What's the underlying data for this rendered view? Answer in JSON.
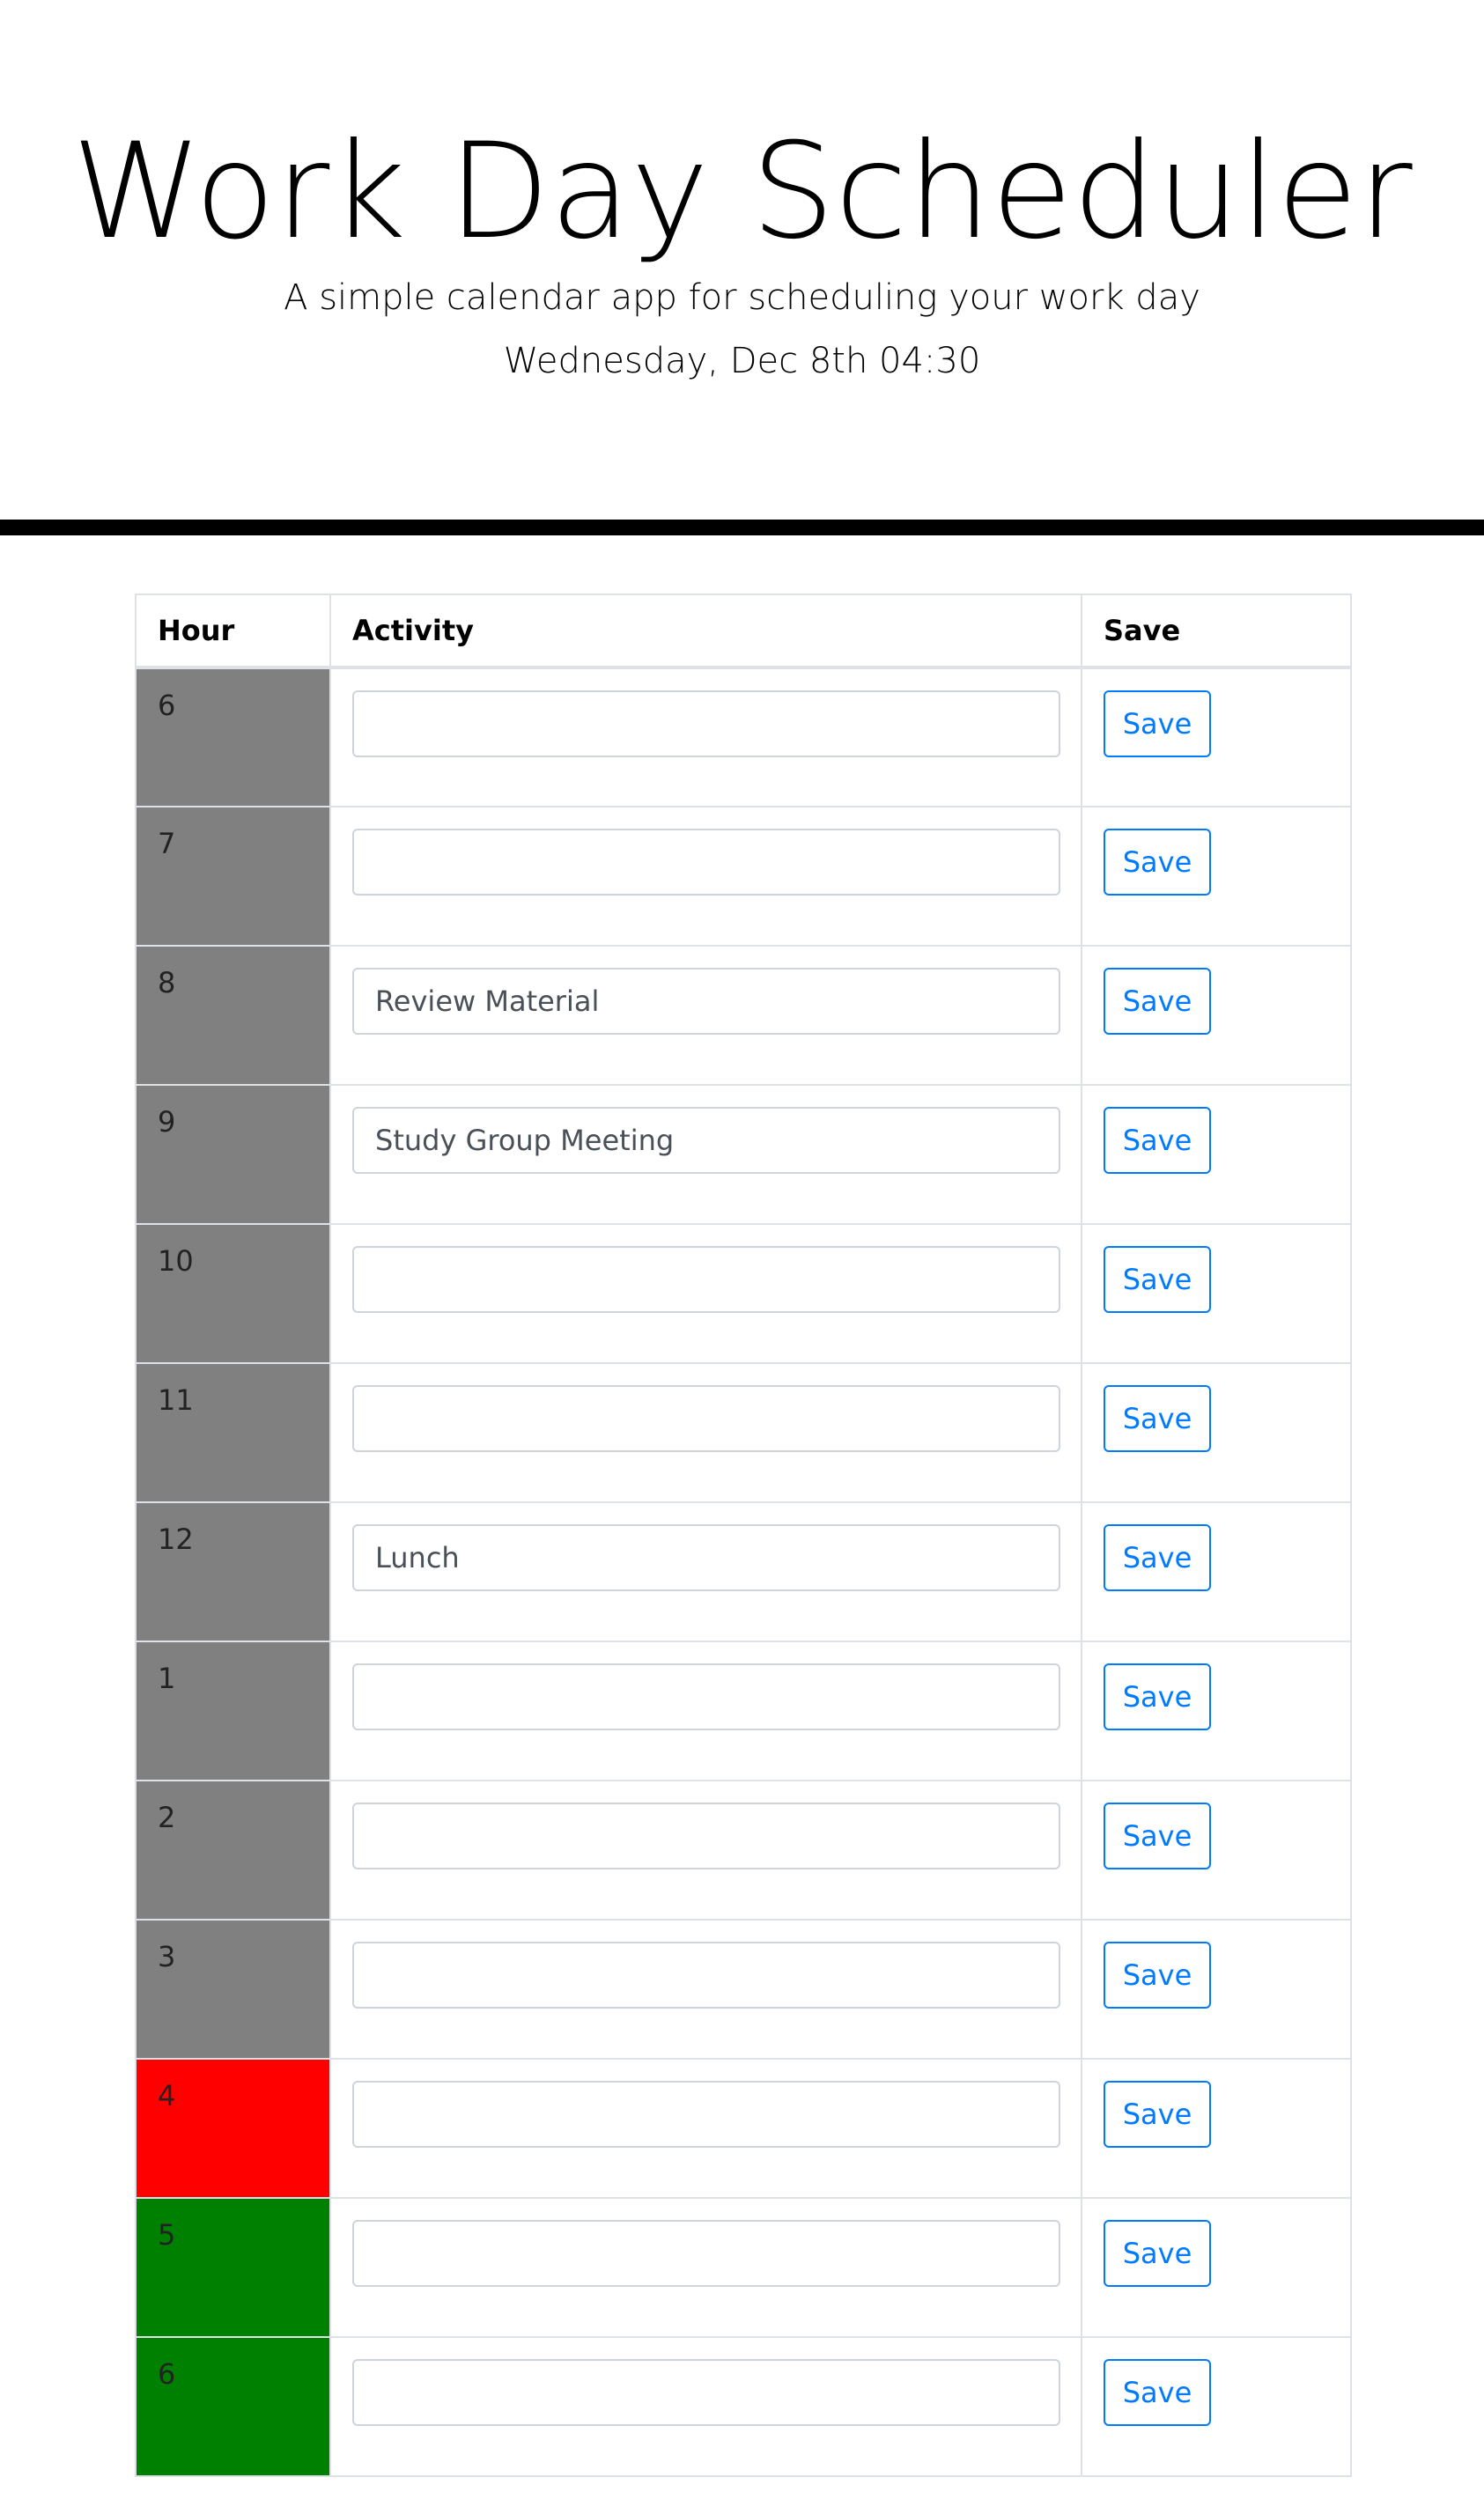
{
  "header": {
    "title": "Work Day Scheduler",
    "subtitle": "A simple calendar app for scheduling your work day",
    "current_date": "Wednesday, Dec 8th 04:30"
  },
  "table": {
    "columns": [
      "Hour",
      "Activity",
      "Save"
    ],
    "save_label": "Save",
    "status_colors": {
      "past": "#808080",
      "present": "#ff0000",
      "future": "#008000"
    },
    "rows": [
      {
        "hour": "6",
        "activity": "",
        "status": "past"
      },
      {
        "hour": "7",
        "activity": "",
        "status": "past"
      },
      {
        "hour": "8",
        "activity": "Review Material",
        "status": "past"
      },
      {
        "hour": "9",
        "activity": "Study Group Meeting",
        "status": "past"
      },
      {
        "hour": "10",
        "activity": "",
        "status": "past"
      },
      {
        "hour": "11",
        "activity": "",
        "status": "past"
      },
      {
        "hour": "12",
        "activity": "Lunch",
        "status": "past"
      },
      {
        "hour": "1",
        "activity": "",
        "status": "past"
      },
      {
        "hour": "2",
        "activity": "",
        "status": "past"
      },
      {
        "hour": "3",
        "activity": "",
        "status": "past"
      },
      {
        "hour": "4",
        "activity": "",
        "status": "present"
      },
      {
        "hour": "5",
        "activity": "",
        "status": "future"
      },
      {
        "hour": "6",
        "activity": "",
        "status": "future"
      }
    ]
  }
}
